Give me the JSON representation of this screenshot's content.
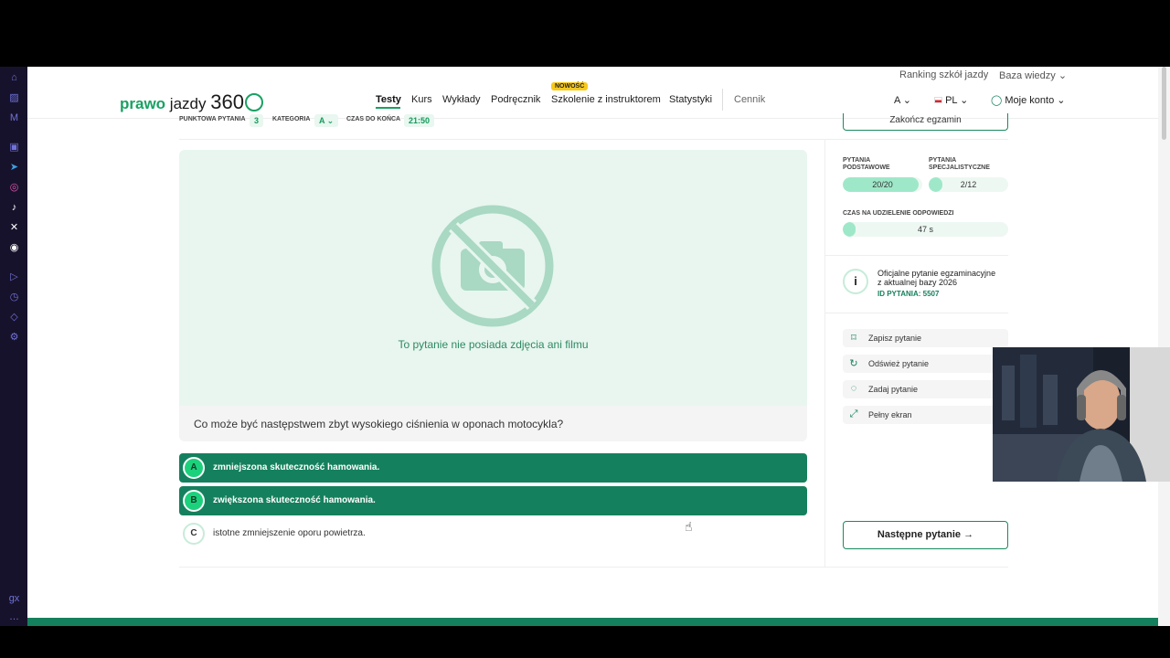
{
  "header": {
    "logo": {
      "prefix": "prawo",
      "middle": "jazdy",
      "number": "360"
    },
    "top_links": [
      "Ranking szkół jazdy",
      "Baza wiedzy"
    ],
    "nav": [
      "Testy",
      "Kurs",
      "Wykłady",
      "Podręcznik",
      "Szkolenie z instruktorem",
      "Statystyki",
      "Cennik"
    ],
    "nav_badge": "NOWOŚĆ",
    "category_select": "A",
    "language_select": "PL",
    "account": "Moje konto"
  },
  "exam_bar": {
    "points_label": "PUNKTOWA PYTANIA",
    "points_value": "3",
    "category_label": "KATEGORIA",
    "category_value": "A",
    "time_label": "CZAS DO KOŃCA",
    "time_value": "21:50",
    "end_button": "Zakończ egzamin"
  },
  "media": {
    "no_media_text": "To pytanie nie posiada zdjęcia ani filmu"
  },
  "question": {
    "text": "Co może być następstwem zbyt wysokiego ciśnienia w oponach motocykla?"
  },
  "answers": [
    {
      "letter": "A",
      "text": "zmniejszona skuteczność hamowania.",
      "selected": true
    },
    {
      "letter": "B",
      "text": "zwiększona skuteczność hamowania.",
      "selected": true
    },
    {
      "letter": "C",
      "text": "istotne zmniejszenie oporu powietrza.",
      "selected": false
    }
  ],
  "progress": {
    "basic_label": "PYTANIA PODSTAWOWE",
    "basic_value": "20/20",
    "basic_fraction": 0.95,
    "special_label": "PYTANIA SPECJALISTYCZNE",
    "special_value": "2/12",
    "special_fraction": 0.17,
    "time_label": "CZAS NA UDZIELENIE ODPOWIEDZI",
    "time_value": "47 s",
    "time_fraction": 0.06
  },
  "info": {
    "line1": "Oficjalne pytanie egzaminacyjne",
    "line2": "z aktualnej bazy 2026",
    "id_line": "ID PYTANIA: 5507"
  },
  "actions": [
    "Zapisz pytanie",
    "Odśwież pytanie",
    "Zadaj pytanie",
    "Pełny ekran"
  ],
  "next_button": "Następne pytanie",
  "colors": {
    "brand_green": "#15805d",
    "accent_green": "#1bd17c",
    "light_green": "#e8f6ef",
    "badge_yellow": "#f7c91c"
  }
}
